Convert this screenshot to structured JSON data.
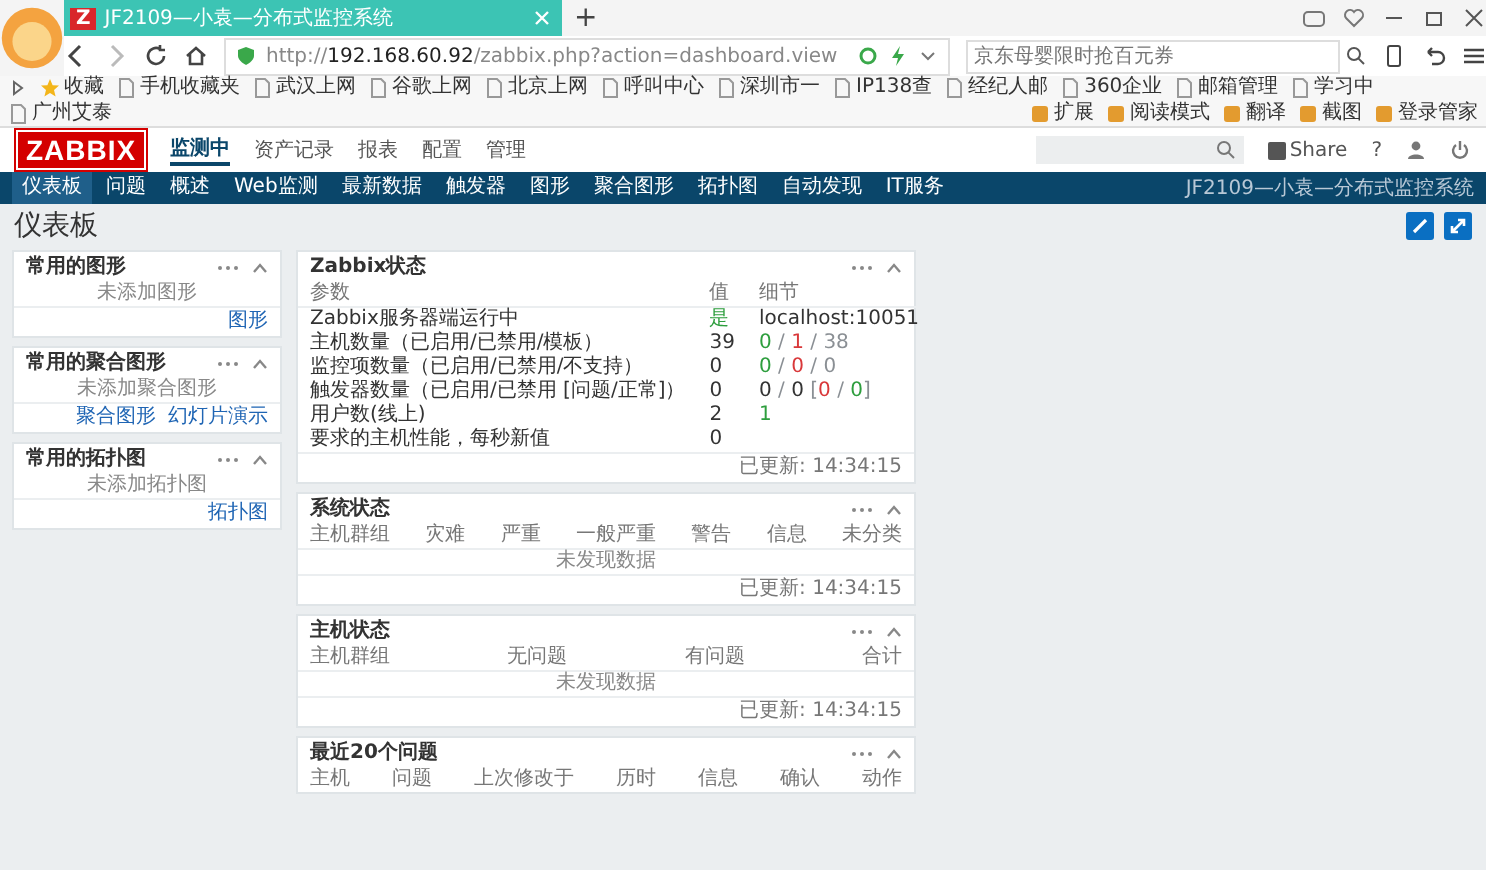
{
  "browser": {
    "tab": {
      "badge": "Z",
      "title": "JF2109—小袁—分布式监控系统"
    },
    "new_tab": "+",
    "address": "http://**192.168.60.92**/zabbix.php?action=dashboard.view",
    "search": {
      "placeholder": "京东母婴限时抢百元券"
    },
    "bookmarks": [
      {
        "label": "收藏"
      },
      {
        "label": "手机收藏夹"
      },
      {
        "label": "武汉上网"
      },
      {
        "label": "谷歌上网"
      },
      {
        "label": "北京上网"
      },
      {
        "label": "呼叫中心"
      },
      {
        "label": "深圳市一"
      },
      {
        "label": "IP138查"
      },
      {
        "label": "经纪人邮"
      },
      {
        "label": "360企业"
      },
      {
        "label": "邮箱管理"
      },
      {
        "label": "学习中"
      },
      {
        "label": "广州艾泰"
      }
    ],
    "tools": [
      {
        "label": "扩展"
      },
      {
        "label": "阅读模式"
      },
      {
        "label": "翻译"
      },
      {
        "label": "截图"
      },
      {
        "label": "登录管家"
      }
    ]
  },
  "app": {
    "logo": "ZABBIX",
    "menu": [
      {
        "label": "监测中",
        "selected": true
      },
      {
        "label": "资产记录",
        "selected": false
      },
      {
        "label": "报表",
        "selected": false
      },
      {
        "label": "配置",
        "selected": false
      },
      {
        "label": "管理",
        "selected": false
      }
    ],
    "share": "Share",
    "help": "?",
    "submenu": [
      {
        "label": "仪表板",
        "selected": true
      },
      {
        "label": "问题",
        "selected": false
      },
      {
        "label": "概述",
        "selected": false
      },
      {
        "label": "Web监测",
        "selected": false
      },
      {
        "label": "最新数据",
        "selected": false
      },
      {
        "label": "触发器",
        "selected": false
      },
      {
        "label": "图形",
        "selected": false
      },
      {
        "label": "聚合图形",
        "selected": false
      },
      {
        "label": "拓扑图",
        "selected": false
      },
      {
        "label": "自动发现",
        "selected": false
      },
      {
        "label": "IT服务",
        "selected": false
      }
    ],
    "server_name": "JF2109—小袁—分布式监控系统",
    "page_title": "仪表板"
  },
  "favourites": [
    {
      "title": "常用的图形",
      "empty": "未添加图形",
      "links": [
        "图形"
      ]
    },
    {
      "title": "常用的聚合图形",
      "empty": "未添加聚合图形",
      "links": [
        "聚合图形",
        "幻灯片演示"
      ]
    },
    {
      "title": "常用的拓扑图",
      "empty": "未添加拓扑图",
      "links": [
        "拓扑图"
      ]
    }
  ],
  "zabbix_status": {
    "title": "Zabbix状态",
    "columns": [
      "参数",
      "值",
      "细节"
    ],
    "rows": [
      {
        "param": "Zabbix服务器端运行中",
        "value": {
          "text": "是",
          "color": "#2e9e3e"
        },
        "detail": [
          {
            "text": "localhost:10051",
            "color": "#333333"
          }
        ]
      },
      {
        "param": "主机数量（已启用/已禁用/模板）",
        "value": {
          "text": "39",
          "color": "#333333"
        },
        "detail": [
          {
            "text": "0",
            "color": "#2e9e3e"
          },
          {
            "text": " / ",
            "color": "#8a8f94"
          },
          {
            "text": "1",
            "color": "#d9383a"
          },
          {
            "text": " / ",
            "color": "#8a8f94"
          },
          {
            "text": "38",
            "color": "#8a8f94"
          }
        ]
      },
      {
        "param": "监控项数量（已启用/已禁用/不支持）",
        "value": {
          "text": "0",
          "color": "#333333"
        },
        "detail": [
          {
            "text": "0",
            "color": "#2e9e3e"
          },
          {
            "text": " / ",
            "color": "#8a8f94"
          },
          {
            "text": "0",
            "color": "#d9383a"
          },
          {
            "text": " / ",
            "color": "#8a8f94"
          },
          {
            "text": "0",
            "color": "#8a8f94"
          }
        ]
      },
      {
        "param": "触发器数量（已启用/已禁用 [问题/正常]）",
        "value": {
          "text": "0",
          "color": "#333333"
        },
        "detail": [
          {
            "text": "0",
            "color": "#333333"
          },
          {
            "text": " / ",
            "color": "#8a8f94"
          },
          {
            "text": "0",
            "color": "#333333"
          },
          {
            "text": " [",
            "color": "#8a8f94"
          },
          {
            "text": "0",
            "color": "#d9383a"
          },
          {
            "text": " / ",
            "color": "#8a8f94"
          },
          {
            "text": "0",
            "color": "#2e9e3e"
          },
          {
            "text": "]",
            "color": "#8a8f94"
          }
        ]
      },
      {
        "param": "用户数(线上)",
        "value": {
          "text": "2",
          "color": "#333333"
        },
        "detail": [
          {
            "text": "1",
            "color": "#2e9e3e"
          }
        ]
      },
      {
        "param": "要求的主机性能，每秒新值",
        "value": {
          "text": "0",
          "color": "#333333"
        },
        "detail": []
      }
    ],
    "updated": "已更新: 14:34:15"
  },
  "system_status": {
    "title": "系统状态",
    "columns": [
      "主机群组",
      "灾难",
      "严重",
      "一般严重",
      "警告",
      "信息",
      "未分类"
    ],
    "empty": "未发现数据",
    "updated": "已更新: 14:34:15"
  },
  "host_status": {
    "title": "主机状态",
    "columns": [
      "主机群组",
      "无问题",
      "有问题",
      "合计"
    ],
    "empty": "未发现数据",
    "updated": "已更新: 14:34:15"
  },
  "problems": {
    "title": "最近20个问题",
    "columns": [
      "主机",
      "问题",
      "上次修改于",
      "历时",
      "信息",
      "确认",
      "动作"
    ]
  }
}
